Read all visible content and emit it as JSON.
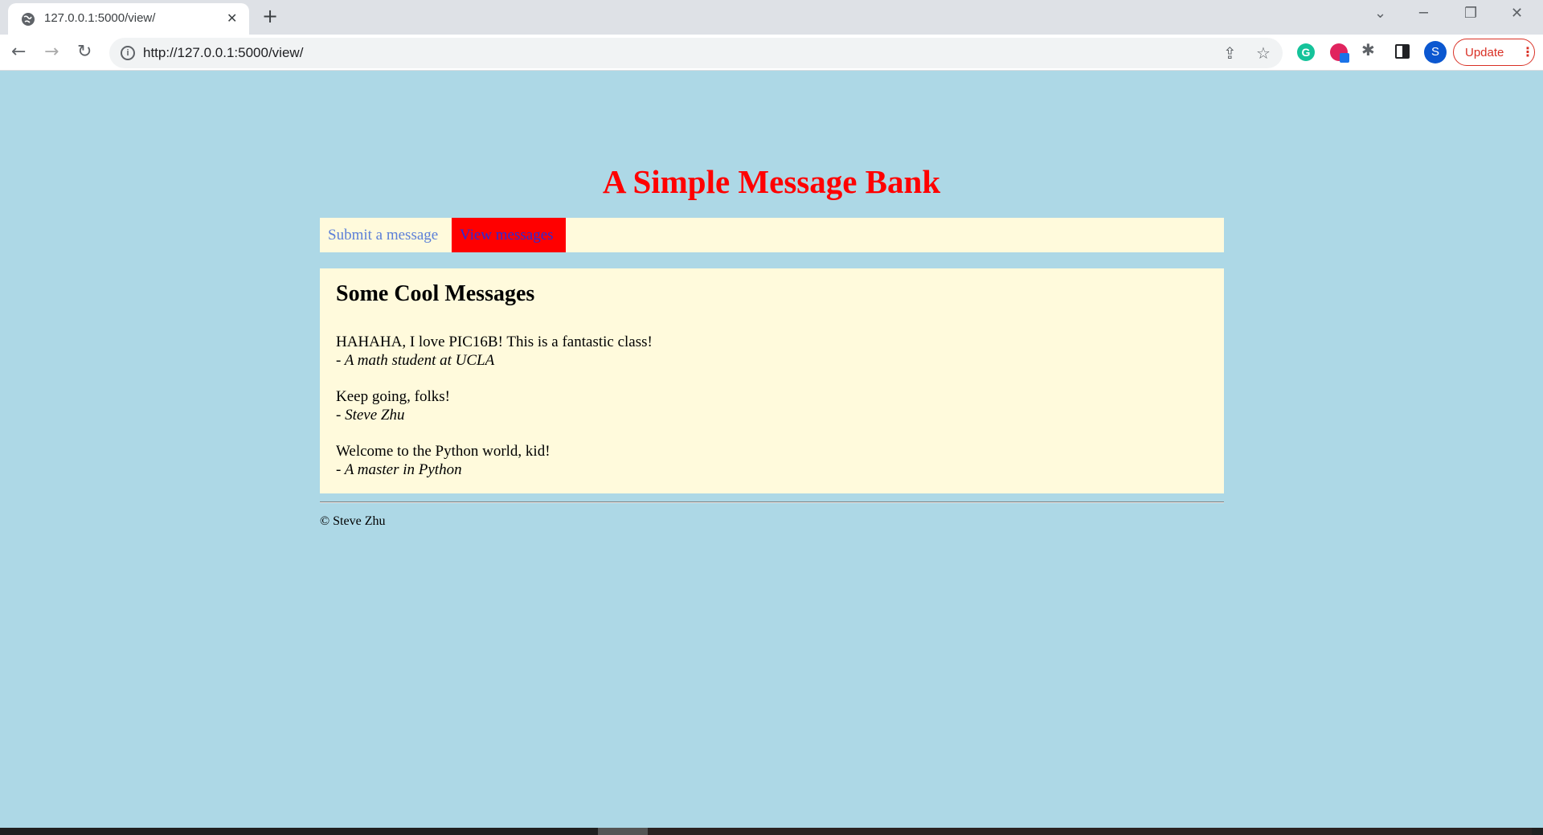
{
  "browser": {
    "tab_title": "127.0.0.1:5000/view/",
    "tab_close": "✕",
    "new_tab": "+",
    "url": "http://127.0.0.1:5000/view/",
    "update_label": "Update",
    "update_menu": "⋮",
    "avatar_letter": "S",
    "grammarly_letter": "G",
    "icons": {
      "back": "←",
      "forward": "→",
      "reload": "↻",
      "info": "i",
      "share": "⇪",
      "star": "☆",
      "puzzle": "✱",
      "tab_search": "⌄",
      "minimize": "─",
      "restore": "❐",
      "close": "✕"
    }
  },
  "page": {
    "title": "A Simple Message Bank",
    "nav": {
      "submit": "Submit a message",
      "view": "View messages"
    },
    "heading": "Some Cool Messages",
    "messages": [
      {
        "text": "HAHAHA, I love PIC16B! This is a fantastic class!",
        "author": "- A math student at UCLA"
      },
      {
        "text": "Keep going, folks!",
        "author": "- Steve Zhu"
      },
      {
        "text": "Welcome to the Python world, kid!",
        "author": "- A master in Python"
      }
    ],
    "footer": "© Steve Zhu"
  }
}
